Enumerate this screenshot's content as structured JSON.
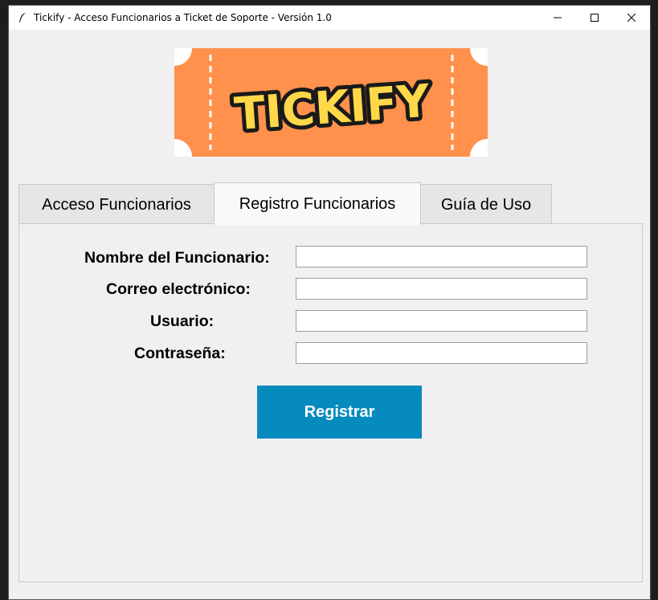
{
  "window": {
    "title": "Tickify - Acceso Funcionarios a Ticket de Soporte - Versión 1.0",
    "minimize": "—",
    "maximize": "☐",
    "close": "✕"
  },
  "logo": {
    "text": "TICKIFY",
    "colors": {
      "ticket": "#ff914d",
      "letters": "#ffd84a",
      "outline": "#1a1a1a"
    }
  },
  "tabs": [
    {
      "label": "Acceso Funcionarios",
      "active": false
    },
    {
      "label": "Registro Funcionarios",
      "active": true
    },
    {
      "label": "Guía de Uso",
      "active": false
    }
  ],
  "form": {
    "nombre_label": "Nombre del Funcionario:",
    "nombre_value": "",
    "correo_label": "Correo electrónico:",
    "correo_value": "",
    "usuario_label": "Usuario:",
    "usuario_value": "",
    "contrasena_label": "Contraseña:",
    "contrasena_value": "",
    "submit_label": "Registrar"
  },
  "colors": {
    "button_bg": "#068bbf",
    "button_text": "#ffffff",
    "window_bg": "#f0f0f0"
  }
}
